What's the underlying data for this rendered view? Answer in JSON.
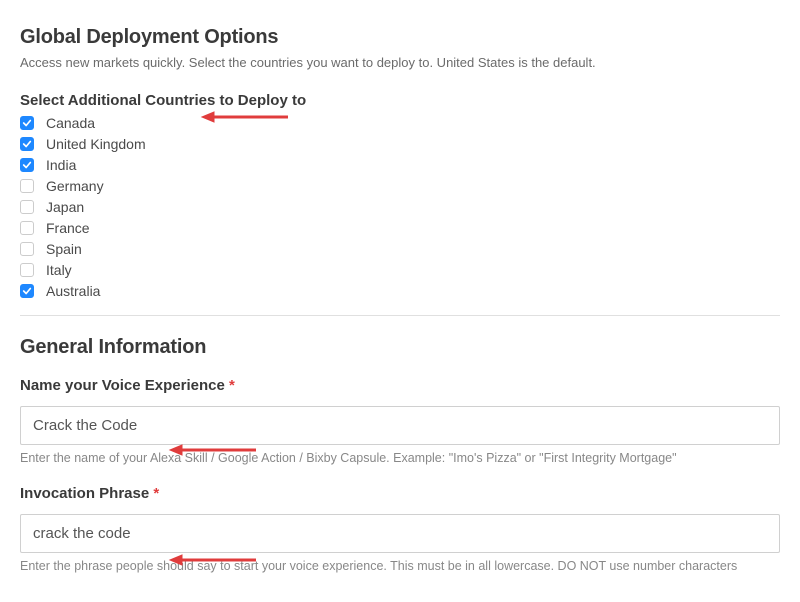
{
  "global": {
    "title": "Global Deployment Options",
    "subtitle": "Access new markets quickly. Select the countries you want to deploy to. United States is the default.",
    "countries_label": "Select Additional Countries to Deploy to",
    "countries": [
      {
        "name": "Canada",
        "checked": true
      },
      {
        "name": "United Kingdom",
        "checked": true
      },
      {
        "name": "India",
        "checked": true
      },
      {
        "name": "Germany",
        "checked": false
      },
      {
        "name": "Japan",
        "checked": false
      },
      {
        "name": "France",
        "checked": false
      },
      {
        "name": "Spain",
        "checked": false
      },
      {
        "name": "Italy",
        "checked": false
      },
      {
        "name": "Australia",
        "checked": true
      }
    ]
  },
  "general": {
    "title": "General Information",
    "name_label": "Name your Voice Experience",
    "name_value": "Crack the Code",
    "name_helper": "Enter the name of your Alexa Skill / Google Action / Bixby Capsule. Example: \"Imo's Pizza\" or \"First Integrity Mortgage\"",
    "invocation_label": "Invocation Phrase",
    "invocation_value": "crack the code",
    "invocation_helper": "Enter the phrase people should say to start your voice experience. This must be in all lowercase. DO NOT use number characters"
  },
  "required_marker": "*"
}
